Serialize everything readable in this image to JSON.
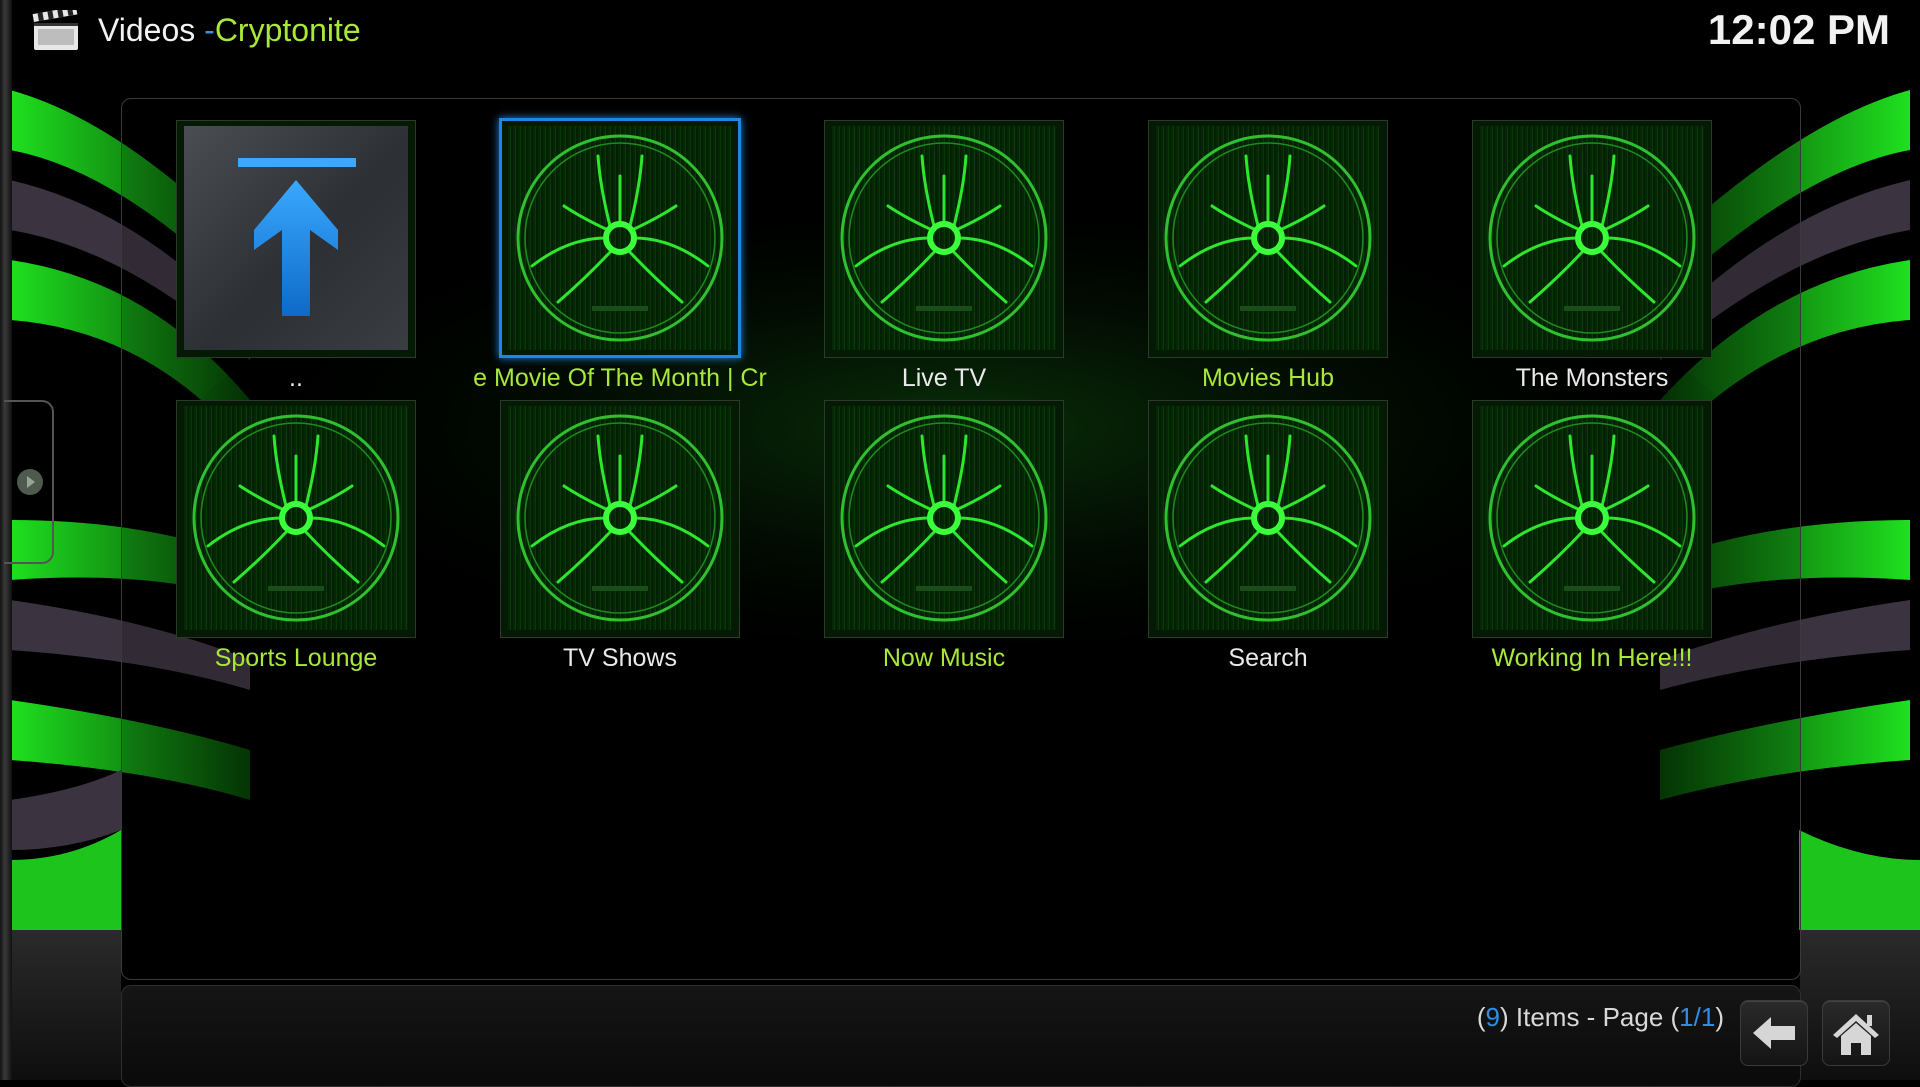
{
  "header": {
    "section": "Videos",
    "separator": "-",
    "addon": "Cryptonite",
    "clock": "12:02 PM",
    "icon": "clapperboard-icon"
  },
  "grid": {
    "items": [
      {
        "label": "..",
        "type": "parent-folder",
        "icon": "up-arrow-icon",
        "color": "white",
        "focused": false
      },
      {
        "label": "e Movie Of The Month | Cr",
        "type": "folder",
        "icon": "cryptonite-spider-icon",
        "color": "green",
        "focused": true
      },
      {
        "label": "Live TV",
        "type": "folder",
        "icon": "cryptonite-spider-icon",
        "color": "white",
        "focused": false
      },
      {
        "label": "Movies Hub",
        "type": "folder",
        "icon": "cryptonite-spider-icon",
        "color": "green",
        "focused": false
      },
      {
        "label": "The Monsters",
        "type": "folder",
        "icon": "cryptonite-spider-icon",
        "color": "white",
        "focused": false
      },
      {
        "label": "Sports Lounge",
        "type": "folder",
        "icon": "cryptonite-spider-icon",
        "color": "green",
        "focused": false
      },
      {
        "label": "TV Shows",
        "type": "folder",
        "icon": "cryptonite-spider-icon",
        "color": "white",
        "focused": false
      },
      {
        "label": "Now Music",
        "type": "folder",
        "icon": "cryptonite-spider-icon",
        "color": "green",
        "focused": false
      },
      {
        "label": "Search",
        "type": "folder",
        "icon": "cryptonite-spider-icon",
        "color": "white",
        "focused": false
      },
      {
        "label": "Working In Here!!!",
        "type": "folder",
        "icon": "cryptonite-spider-icon",
        "color": "green",
        "focused": false
      }
    ]
  },
  "footer": {
    "open_paren": "(",
    "item_count": "9",
    "items_text": ") Items - Page (",
    "page": "1/1",
    "close_paren": ")",
    "back_icon": "back-arrow-icon",
    "home_icon": "home-icon"
  },
  "colors": {
    "accent_blue": "#1e86e6",
    "label_green": "#a8e83a",
    "label_white": "#eaeaea",
    "theme_green": "#2ee62e"
  }
}
